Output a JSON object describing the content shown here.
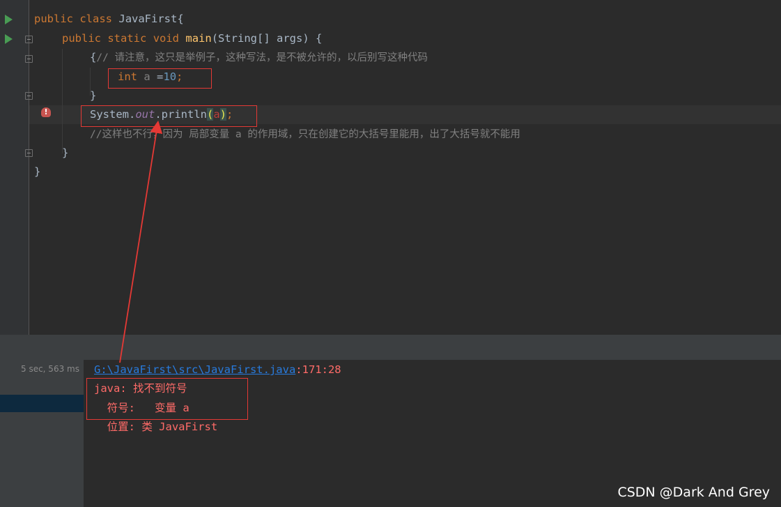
{
  "editor": {
    "lines": {
      "l1": {
        "kw1": "public",
        "kw2": "class",
        "name": "JavaFirst{"
      },
      "l2": {
        "kw1": "public",
        "kw2": "static",
        "kw3": "void",
        "fn": "main",
        "rest": "(String[] args) {"
      },
      "l3": {
        "brace": "{",
        "comment": "// 请注意，这只是举例子，这种写法，是不被允许的，以后别写这种代码"
      },
      "l4": {
        "kw": "int",
        "var": "a",
        "eq": "=",
        "num": "10",
        "semi": ";"
      },
      "l5": {
        "brace": "}"
      },
      "l6": {
        "sys": "System.",
        "field": "out",
        "method": ".println",
        "open": "(",
        "arg": "a",
        "close": ")",
        "semi": ";"
      },
      "l7": {
        "comment": "//这样也不行，因为 局部变量 a 的作用域，只在创建它的大括号里能用，出了大括号就不能用"
      },
      "l8": {
        "brace": "}"
      },
      "l9": {
        "brace": "}"
      }
    }
  },
  "run_panel": {
    "elapsed": "5 sec, 563 ms"
  },
  "console": {
    "path_link": "G:\\JavaFirst\\src\\JavaFirst.java",
    "position": ":171:28",
    "error_title": "java: 找不到符号",
    "symbol_line": "  符号:   变量 a",
    "location_line": "  位置: 类 JavaFirst"
  },
  "watermark": "CSDN @Dark And Grey",
  "colors": {
    "editor_bg": "#2b2b2b",
    "keyword": "#cc7832",
    "annotation_box": "#e53935",
    "error_text": "#ff6b68",
    "link": "#287bde"
  }
}
